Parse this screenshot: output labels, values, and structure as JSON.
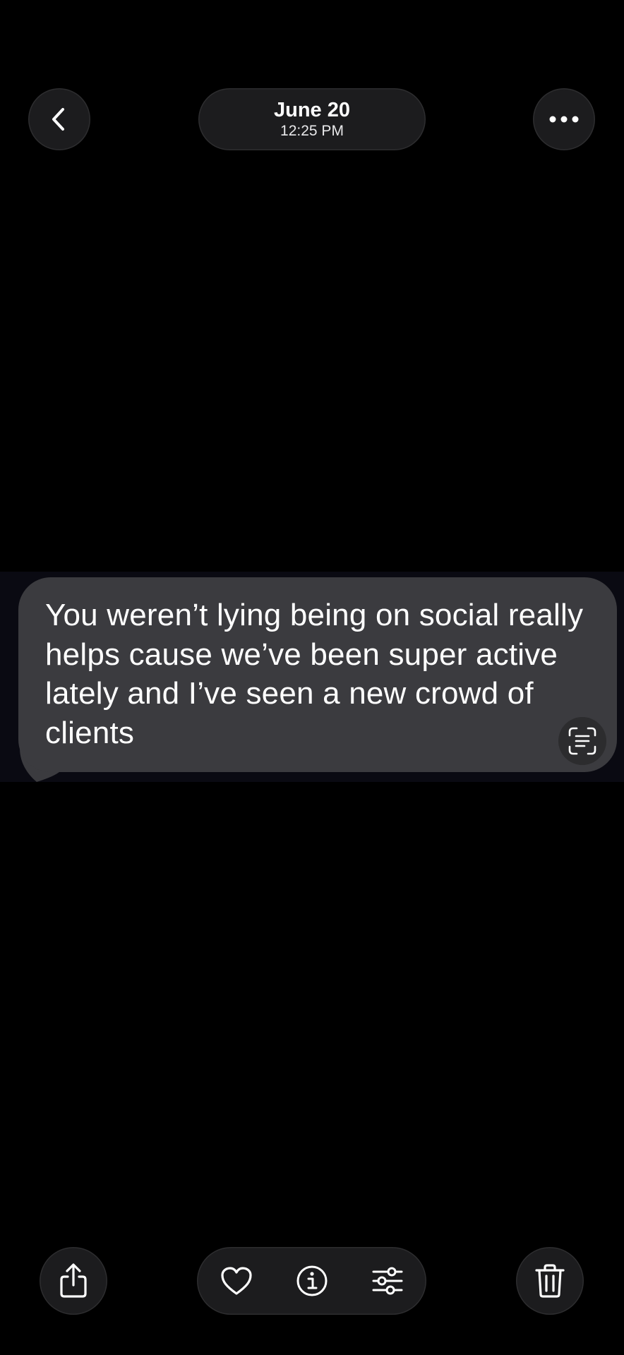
{
  "header": {
    "back_icon": "chevron-left-icon",
    "date": "June 20",
    "time": "12:25 PM",
    "more_icon": "ellipsis-icon"
  },
  "message": {
    "text": "You weren’t lying being on social really helps cause we’ve been super active lately and I’ve seen a new crowd of clients",
    "scan_icon": "live-text-icon",
    "bubble_color": "#3b3b3f"
  },
  "toolbar": {
    "share_icon": "share-icon",
    "favorite_icon": "heart-icon",
    "info_icon": "info-icon",
    "adjust_icon": "sliders-icon",
    "delete_icon": "trash-icon"
  },
  "colors": {
    "background": "#000000",
    "control_fill": "#1c1c1e"
  }
}
